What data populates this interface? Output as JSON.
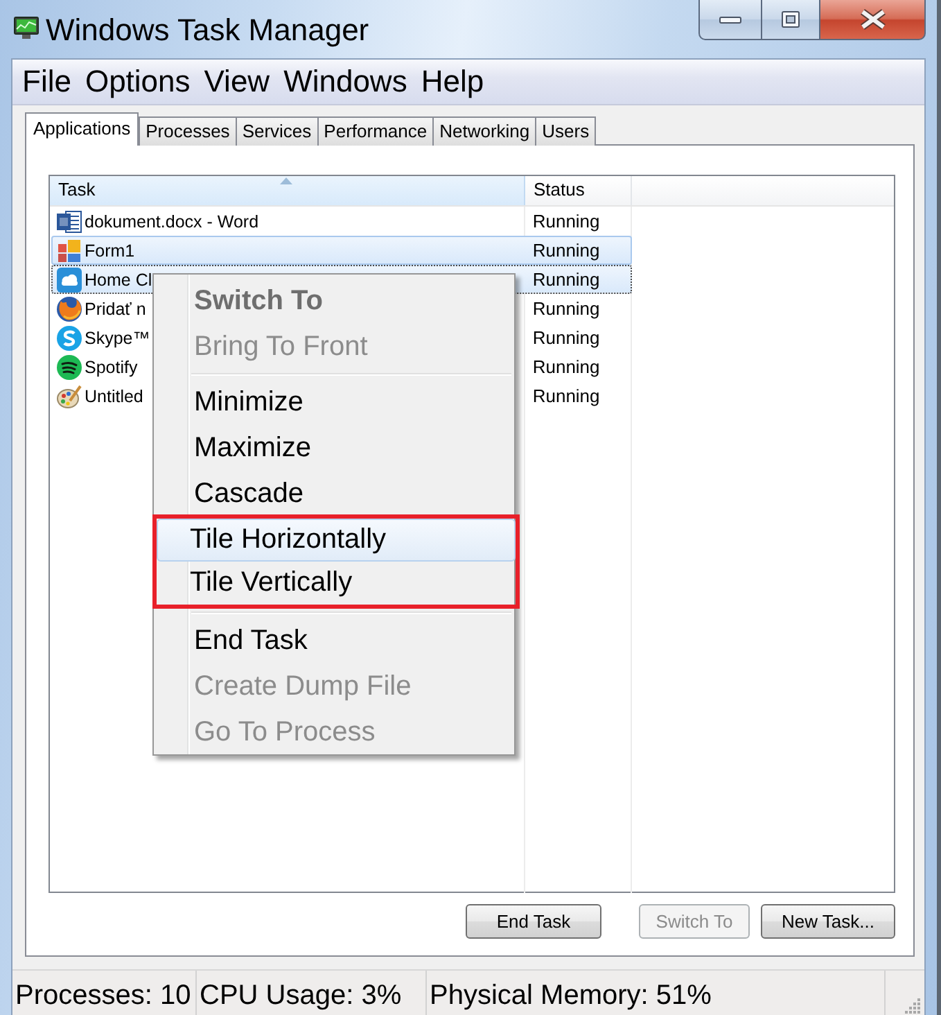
{
  "window": {
    "title": "Windows Task Manager"
  },
  "menu_bar": [
    "File",
    "Options",
    "View",
    "Windows",
    "Help"
  ],
  "tabs": [
    {
      "label": "Applications",
      "selected": true
    },
    {
      "label": "Processes",
      "selected": false
    },
    {
      "label": "Services",
      "selected": false
    },
    {
      "label": "Performance",
      "selected": false
    },
    {
      "label": "Networking",
      "selected": false
    },
    {
      "label": "Users",
      "selected": false
    }
  ],
  "task_list": {
    "columns": [
      {
        "label": "Task",
        "sorted": true
      },
      {
        "label": "Status",
        "sorted": false
      }
    ],
    "rows": [
      {
        "task": "dokument.docx - Word",
        "status": "Running",
        "selected": false,
        "focused": false
      },
      {
        "task": "Form1",
        "status": "Running",
        "selected": true,
        "focused": false
      },
      {
        "task": "Home Cl",
        "status": "Running",
        "selected": true,
        "focused": true
      },
      {
        "task": "Pridať n",
        "status": "Running",
        "selected": false,
        "focused": false
      },
      {
        "task": "Skype™",
        "status": "Running",
        "selected": false,
        "focused": false
      },
      {
        "task": "Spotify",
        "status": "Running",
        "selected": false,
        "focused": false
      },
      {
        "task": "Untitled",
        "status": "Running",
        "selected": false,
        "focused": false
      }
    ]
  },
  "context_menu": {
    "groups": [
      {
        "kind": "items",
        "outlined": false,
        "items": [
          {
            "label": "Switch To",
            "bold": true,
            "disabled": true,
            "hovered": false
          },
          {
            "label": "Bring To Front",
            "bold": false,
            "disabled": true,
            "hovered": false
          }
        ]
      },
      {
        "kind": "separator"
      },
      {
        "kind": "items",
        "outlined": false,
        "items": [
          {
            "label": "Minimize",
            "bold": false,
            "disabled": false,
            "hovered": false
          },
          {
            "label": "Maximize",
            "bold": false,
            "disabled": false,
            "hovered": false
          },
          {
            "label": "Cascade",
            "bold": false,
            "disabled": false,
            "hovered": false
          }
        ]
      },
      {
        "kind": "items",
        "outlined": true,
        "items": [
          {
            "label": "Tile Horizontally",
            "bold": false,
            "disabled": false,
            "hovered": true
          },
          {
            "label": "Tile Vertically",
            "bold": false,
            "disabled": false,
            "hovered": false
          }
        ]
      },
      {
        "kind": "separator"
      },
      {
        "kind": "items",
        "outlined": false,
        "items": [
          {
            "label": "End Task",
            "bold": false,
            "disabled": false,
            "hovered": false
          },
          {
            "label": "Create Dump File",
            "bold": false,
            "disabled": true,
            "hovered": false
          },
          {
            "label": "Go To Process",
            "bold": false,
            "disabled": true,
            "hovered": false
          }
        ]
      }
    ]
  },
  "buttons": [
    {
      "label": "End Task",
      "disabled": false
    },
    {
      "label": "Switch To",
      "disabled": true
    },
    {
      "label": "New Task...",
      "disabled": false
    }
  ],
  "status_bar": [
    "Processes: 10",
    "CPU Usage: 3%",
    "Physical Memory: 51%"
  ]
}
